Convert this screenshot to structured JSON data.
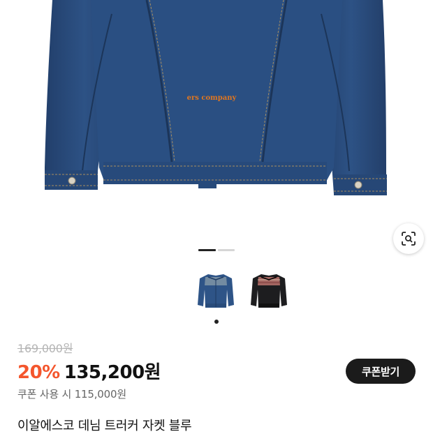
{
  "product": {
    "name": "이알에스코 데님 트러커 자켓 블루",
    "brand_print": "ers company",
    "original_price": "169,000원",
    "discount_rate": "20%",
    "sale_price": "135,200원",
    "coupon_price_text": "쿠폰 사용 시 115,000원",
    "coupon_button_label": "쿠폰받기"
  },
  "gallery": {
    "current_index": 1,
    "total_pages": 2,
    "thumbnails": [
      {
        "color": "denim-blue",
        "selected": true
      },
      {
        "color": "black",
        "selected": false
      }
    ]
  },
  "icons": {
    "image_search": "lens-search-icon"
  },
  "colors": {
    "discount": "#f4562d",
    "denim": "#2b5183",
    "button_bg": "#1b1b1b",
    "original_price": "#b4b4b4",
    "logo_print": "#e0761f"
  }
}
